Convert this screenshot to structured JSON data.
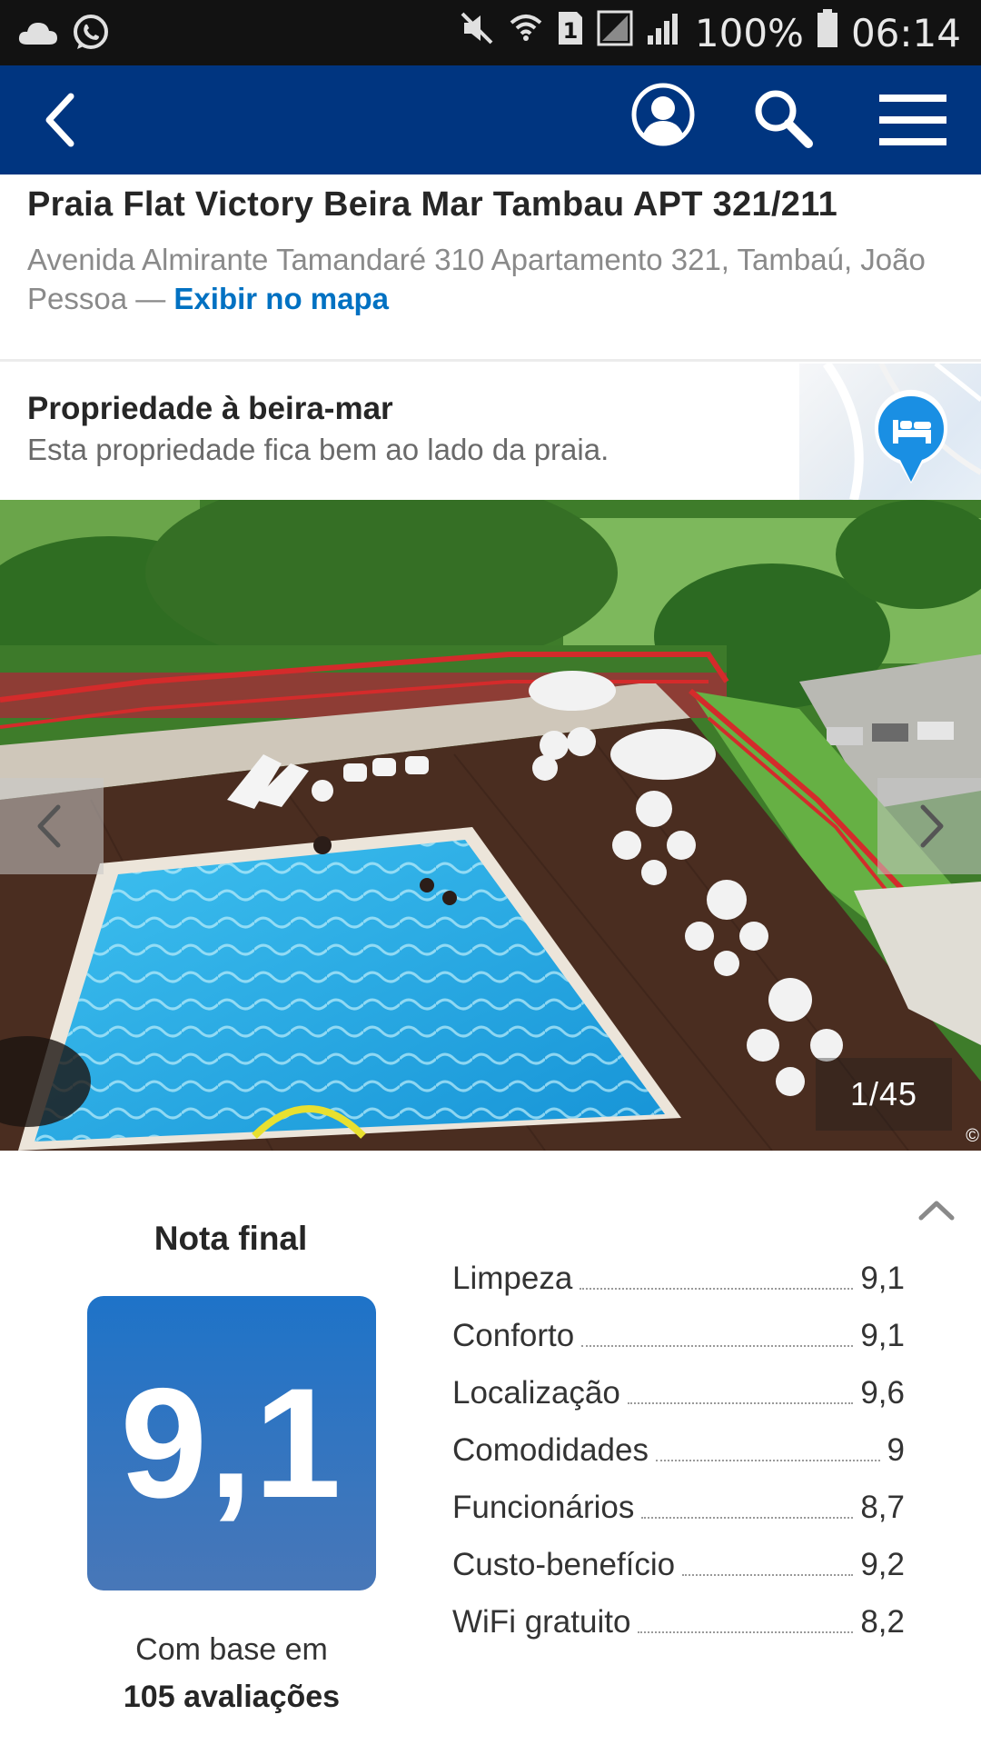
{
  "status_bar": {
    "battery_percent": "100%",
    "time": "06:14",
    "sim_slot": "1",
    "icons": [
      "cloud-icon",
      "whatsapp-icon",
      "mute-icon",
      "wifi-icon",
      "sim-icon",
      "signal-icon",
      "battery-icon"
    ]
  },
  "header": {
    "background": "#003580",
    "icons": [
      "back-arrow-icon",
      "account-icon",
      "search-icon",
      "menu-icon"
    ]
  },
  "property": {
    "title": "Praia Flat Victory Beira Mar Tambau APT 321/211",
    "address": "Avenida Almirante Tamandaré 310 Apartamento 321, Tambaú, João Pessoa — ",
    "map_link": "Exibir no mapa",
    "link_color": "#0071c2"
  },
  "beachfront": {
    "title": "Propriedade à beira-mar",
    "description": "Esta propriedade fica bem ao lado da praia."
  },
  "gallery": {
    "counter": "1/45",
    "copyright": "©"
  },
  "score": {
    "label": "Nota final",
    "value": "9,1",
    "based_on": "Com base em",
    "count": "105 avaliações",
    "categories": [
      {
        "name": "Limpeza",
        "value": "9,1"
      },
      {
        "name": "Conforto",
        "value": "9,1"
      },
      {
        "name": "Localização",
        "value": "9,6"
      },
      {
        "name": "Comodidades",
        "value": "9"
      },
      {
        "name": "Funcionários",
        "value": "8,7"
      },
      {
        "name": "Custo-benefício",
        "value": "9,2"
      },
      {
        "name": "WiFi gratuito",
        "value": "8,2"
      }
    ]
  }
}
